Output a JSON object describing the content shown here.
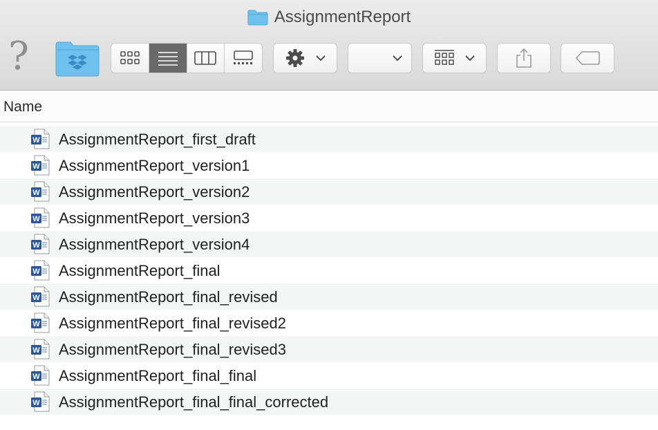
{
  "window": {
    "title": "AssignmentReport"
  },
  "toolbar": {
    "help_glyph": "?",
    "buttons": [
      "help",
      "dropbox",
      "view-icons",
      "view-list",
      "view-columns",
      "view-gallery",
      "action",
      "arrange",
      "group",
      "share",
      "tags"
    ]
  },
  "list": {
    "column_header": "Name",
    "files": [
      "AssignmentReport_first_draft",
      "AssignmentReport_version1",
      "AssignmentReport_version2",
      "AssignmentReport_version3",
      "AssignmentReport_version4",
      "AssignmentReport_final",
      "AssignmentReport_final_revised",
      "AssignmentReport_final_revised2",
      "AssignmentReport_final_revised3",
      "AssignmentReport_final_final",
      "AssignmentReport_final_final_corrected"
    ]
  },
  "colors": {
    "folder_blue": "#6fc1ee",
    "word_blue": "#2b5797",
    "active_segment": "#6a6a6a"
  }
}
